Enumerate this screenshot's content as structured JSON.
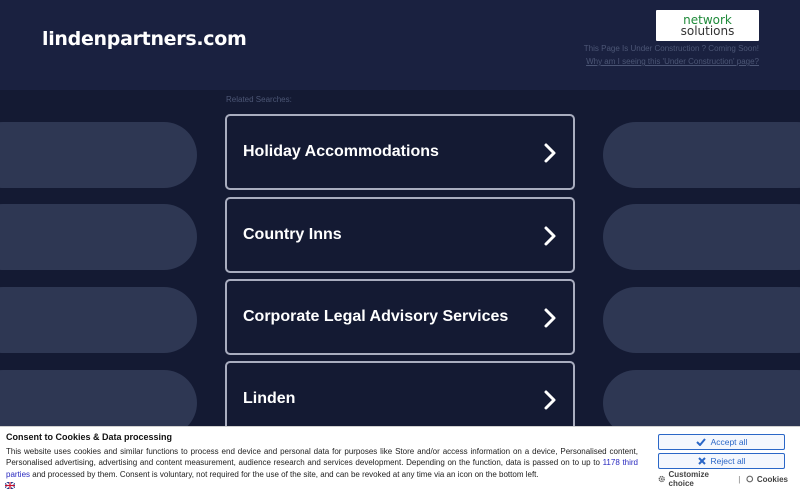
{
  "header": {
    "domain": "lindenpartners.com",
    "logo": {
      "line1": "network",
      "line2": "solutions"
    },
    "under_construction_text": "This Page Is Under Construction ? Coming Soon!",
    "why_link": "Why am I seeing this 'Under Construction' page?"
  },
  "main": {
    "related_label": "Related Searches:",
    "links": [
      {
        "label": "Holiday Accommodations"
      },
      {
        "label": "Country Inns"
      },
      {
        "label": "Corporate Legal Advisory Services"
      },
      {
        "label": "Linden"
      }
    ]
  },
  "cookie_banner": {
    "title": "Consent to Cookies & Data processing",
    "body_part1": "This website uses cookies and similar functions to process end device and personal data for purposes like Store and/or access information on a device, Personalised content, Personalised advertising, advertising and content measurement, audience research and services development. Depending on the function, data is passed on to up to ",
    "third_parties_link": "1178 third parties",
    "body_part2": " and processed by them. Consent is voluntary, not required for the use of the site, and can be revoked at any time via an icon on the bottom left.",
    "accept_label": "Accept all",
    "reject_label": "Reject all",
    "customize_label": "Customize choice",
    "separator": "|",
    "cookies_label": "Cookies"
  },
  "colors": {
    "background": "#141a33",
    "accent_blue": "#2b67c7",
    "logo_green": "#1f8a3a"
  }
}
